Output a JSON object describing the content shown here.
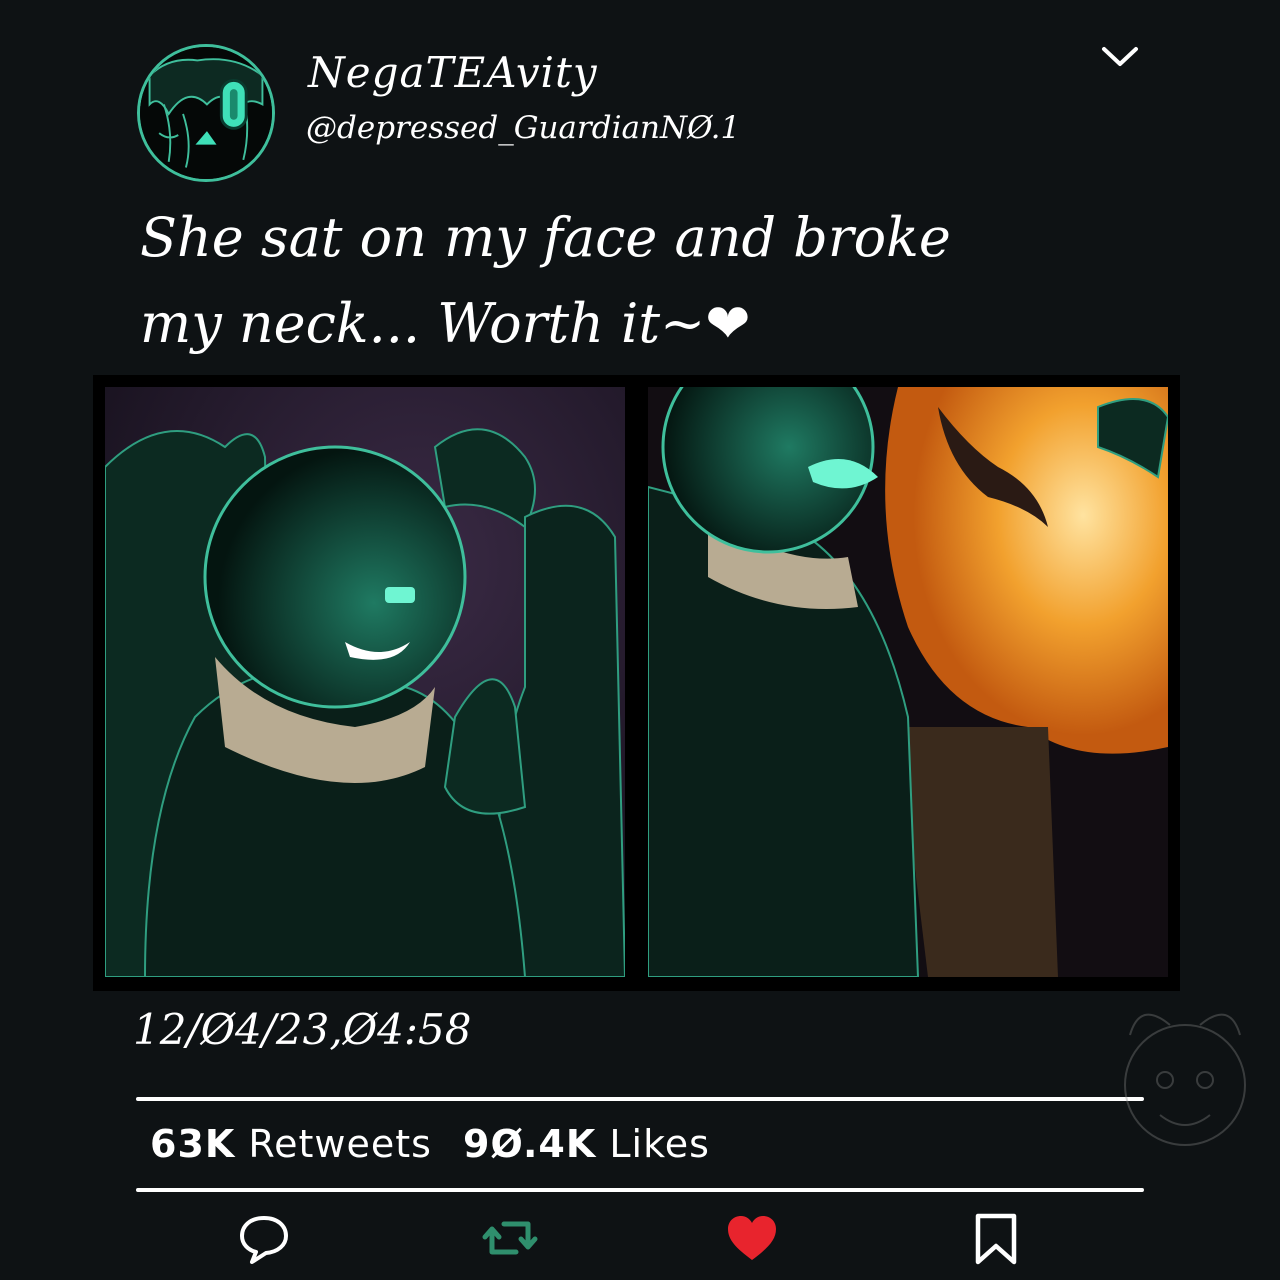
{
  "profile": {
    "display_name": "NegaTEAvity",
    "handle": "@depressed_GuardianNØ.1",
    "avatar_icon": "avatar-goo-skull-icon"
  },
  "menu_icon": "chevron-down-icon",
  "tweet": {
    "text": "She sat on my face and broke my neck... Worth it~",
    "emoji": "❤"
  },
  "timestamp": "12/Ø4/23,Ø4:58",
  "stats": {
    "retweets_count": "63K",
    "retweets_label": "Retweets",
    "likes_count": "9Ø.4K",
    "likes_label": "Likes"
  },
  "actions": [
    {
      "name": "reply",
      "icon": "speech-bubble-icon"
    },
    {
      "name": "retweet",
      "icon": "retweet-icon"
    },
    {
      "name": "like",
      "icon": "heart-icon"
    },
    {
      "name": "bookmark",
      "icon": "bookmark-icon"
    }
  ],
  "colors": {
    "background": "#0e1214",
    "accent_teal": "#3fbf9c",
    "retweet_green": "#2f8f6d",
    "like_red": "#e8242d",
    "text": "#ffffff"
  }
}
